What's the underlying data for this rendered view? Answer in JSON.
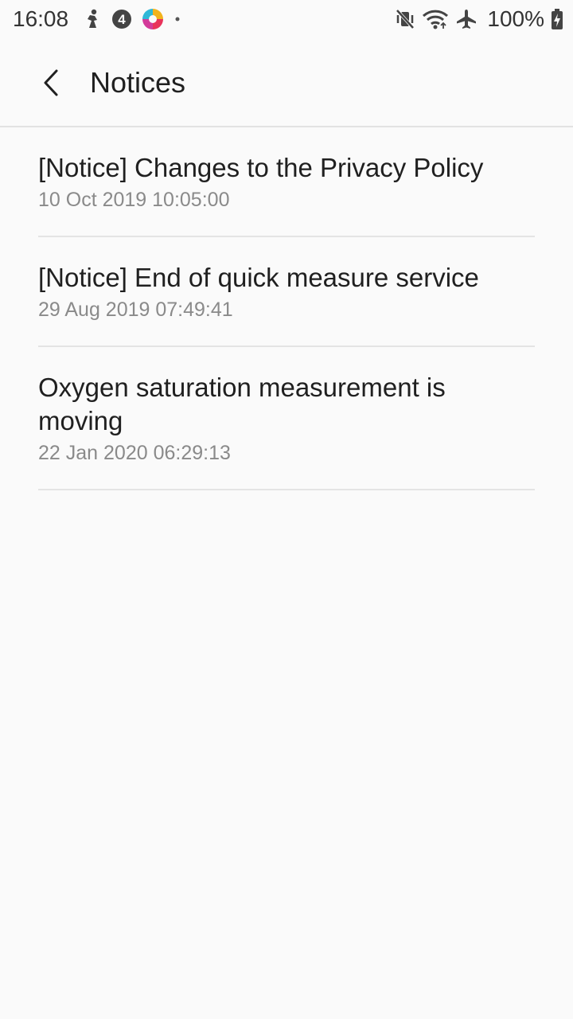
{
  "status_bar": {
    "time": "16:08",
    "battery": "100%",
    "left_icons": [
      "running-person-icon",
      "notification-4-icon",
      "colorful-app-icon",
      "dot-icon"
    ],
    "right_icons": [
      "vibrate-mute-icon",
      "wifi-icon",
      "airplane-icon",
      "battery-charging-icon"
    ]
  },
  "header": {
    "title": "Notices",
    "back_icon": "chevron-left-icon"
  },
  "notices": [
    {
      "title": "[Notice] Changes to the Privacy Policy",
      "date": "10 Oct 2019 10:05:00"
    },
    {
      "title": "[Notice] End of quick measure service",
      "date": "29 Aug 2019 07:49:41"
    },
    {
      "title": "Oxygen saturation measurement is moving",
      "date": "22 Jan 2020 06:29:13"
    }
  ]
}
